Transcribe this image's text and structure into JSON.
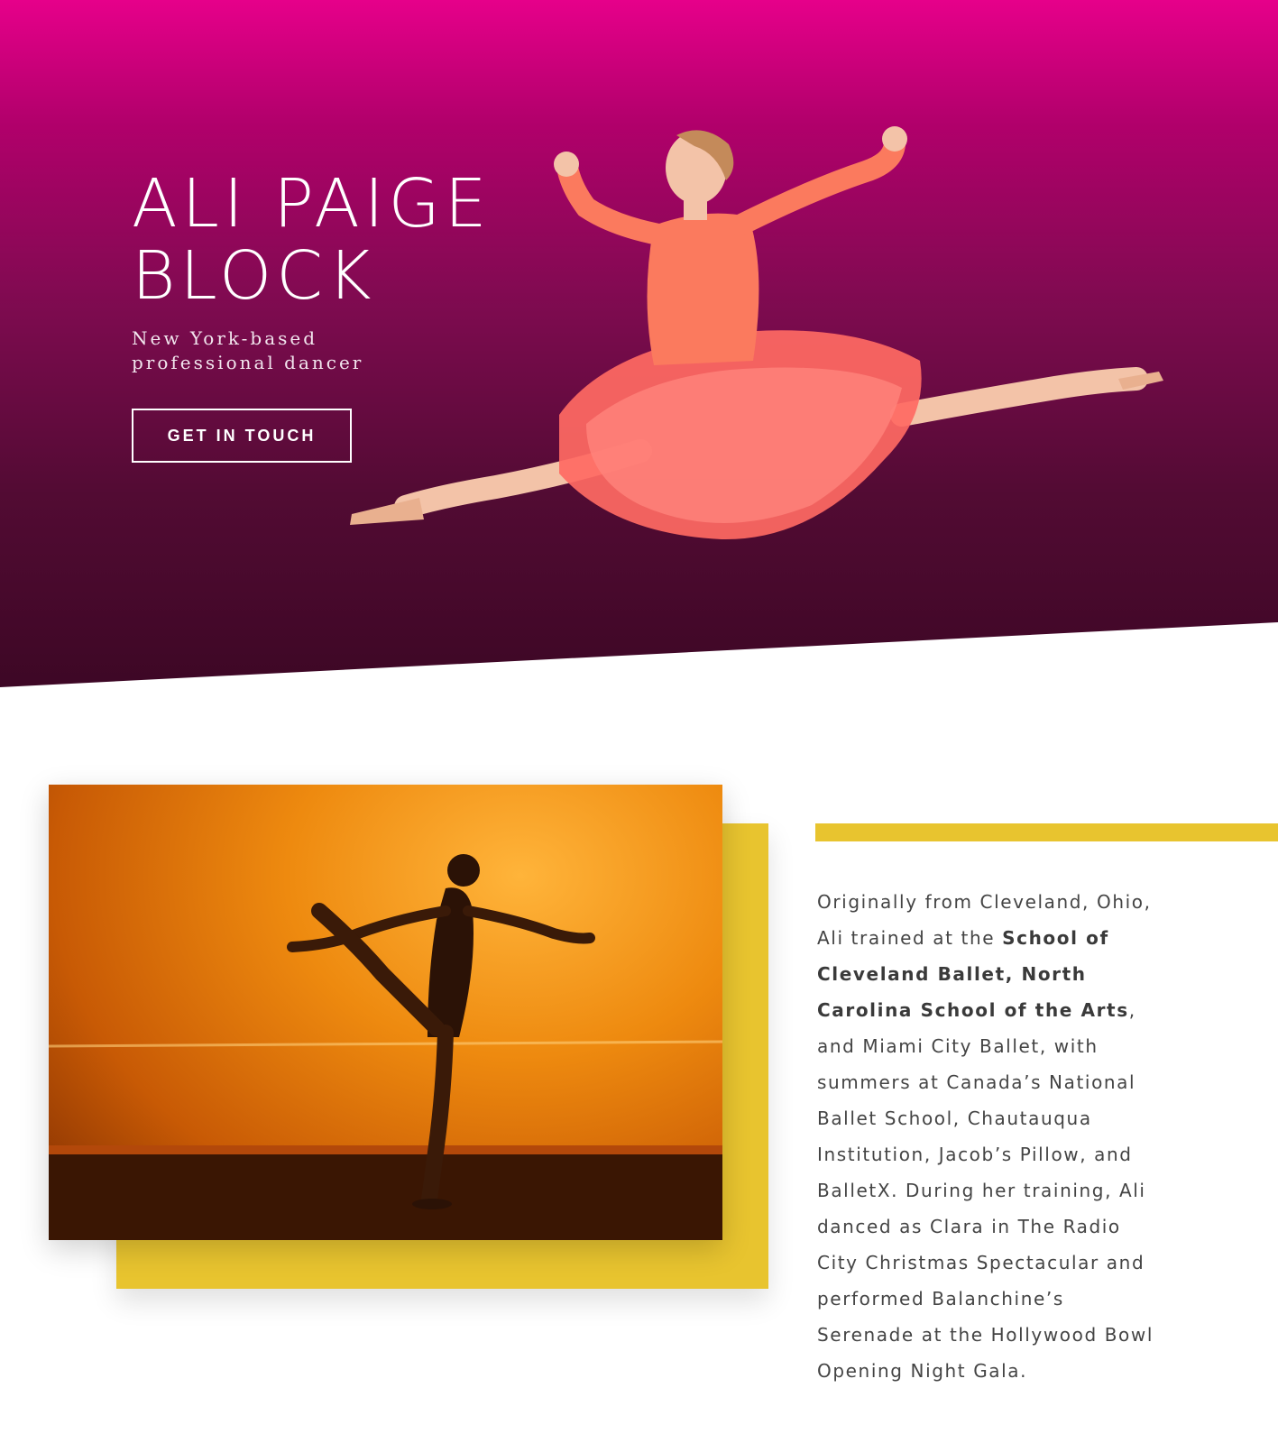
{
  "hero": {
    "title": "ALI PAIGE BLOCK",
    "subtitle": "New York-based professional dancer",
    "cta_label": "GET IN TOUCH",
    "gradient_top": "#e6008a",
    "gradient_bottom": "#3d0725",
    "image": "dancer-leaping-in-coral-tutu"
  },
  "about": {
    "image": "dancer-silhouette-orange-wall",
    "accent_color": "#e8c42f",
    "bio": {
      "p1": "Originally from Cleveland, Ohio, Ali trained at the ",
      "b1": "School of Cleveland Ballet, North Carolina School of the Arts",
      "p2": ", and Miami City Ballet, with summers at Canada’s National Ballet School, Chautauqua Institution, Jacob’s Pillow, and BalletX. During her training, Ali danced as Clara in The Radio City Christmas Spectacular and performed Balanchine’s Serenade at the Hollywood Bowl Opening Night Gala."
    }
  }
}
